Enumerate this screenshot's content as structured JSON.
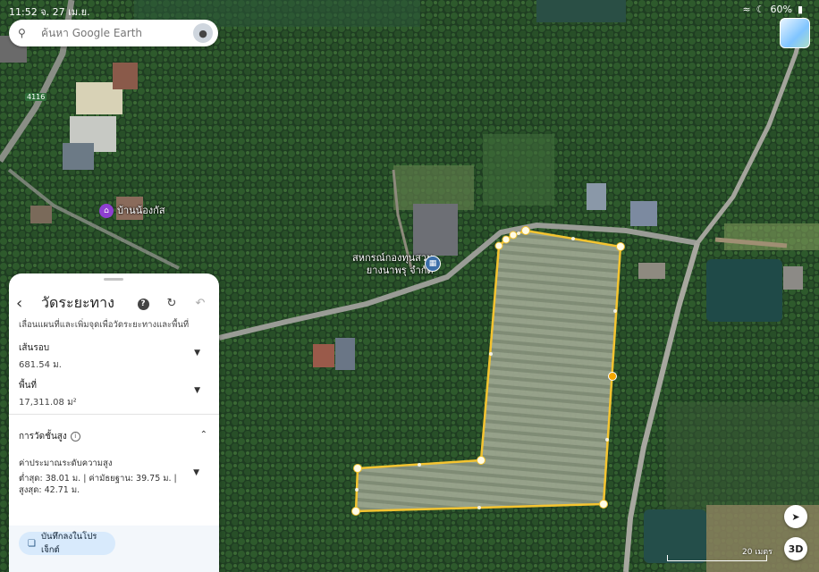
{
  "status_bar": {
    "time": "11:52",
    "date": "จ. 27 เม.ย.",
    "battery": "60%"
  },
  "search": {
    "placeholder": "ค้นหา Google Earth",
    "icon": "search-icon"
  },
  "map": {
    "road_label": "4116",
    "places": [
      {
        "name": "บ้านน้องกัส",
        "icon": "home-icon",
        "color": "#8e3fd1"
      },
      {
        "name": "สหกรณ์กองทุนสวน\nยางนาพรุ จำกัด",
        "icon": "building-icon",
        "color": "#3b6ea8"
      }
    ],
    "scale_label": "20 เมตร",
    "polygon_color": "#f4c430",
    "threeD_label": "3D"
  },
  "panel": {
    "title": "วัดระยะทาง",
    "hint": "เลื่อนแผนที่และเพิ่มจุดเพื่อวัดระยะทางและพื้นที่",
    "perimeter_label": "เส้นรอบ",
    "perimeter_value": "681.54 ม.",
    "area_label": "พื้นที่",
    "area_value": "17,311.08 ม²",
    "elevation_section": "การวัดชั้นสูง",
    "elevation_label": "ค่าประมาณระดับความสูง",
    "elevation_value": "ต่ำสุด: 38.01 ม. | ค่ามัธยฐาน: 39.75 ม. |\nสูงสุด: 42.71 ม.",
    "save_label": "บันทึกลงในโปรเจ็กต์"
  }
}
